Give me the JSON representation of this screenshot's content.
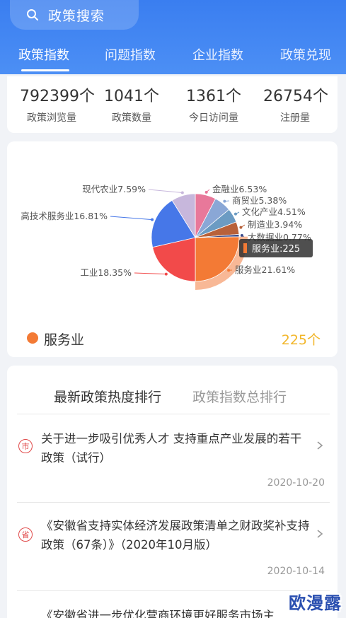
{
  "search": {
    "placeholder": "政策搜索",
    "icon": "search-icon"
  },
  "tabs": [
    {
      "label": "政策指数",
      "active": true
    },
    {
      "label": "问题指数"
    },
    {
      "label": "企业指数"
    },
    {
      "label": "政策兑现"
    }
  ],
  "stats": [
    {
      "value": "792399个",
      "label": "政策浏览量"
    },
    {
      "value": "1041个",
      "label": "政策数量"
    },
    {
      "value": "1361个",
      "label": "今日访问量"
    },
    {
      "value": "26754个",
      "label": "注册量"
    }
  ],
  "chart_data": {
    "type": "pie",
    "slices": [
      {
        "label": "金融业6.53%",
        "name": "金融业",
        "value": 6.53,
        "color": "#e8789a"
      },
      {
        "label": "商贸业5.38%",
        "name": "商贸业",
        "value": 5.38,
        "color": "#8aa7d6"
      },
      {
        "label": "文化产业4.51%",
        "name": "文化产业",
        "value": 4.51,
        "color": "#6b9bc3"
      },
      {
        "label": "制造业3.94%",
        "name": "制造业",
        "value": 3.94,
        "color": "#b8613a"
      },
      {
        "label": "大数据业0.77%",
        "name": "大数据业",
        "value": 0.77,
        "color": "#3a4a8a"
      },
      {
        "label": "服务业21.61%",
        "name": "服务业",
        "value": 21.61,
        "color": "#f37a35"
      },
      {
        "label": "工业18.35%",
        "name": "工业",
        "value": 18.35,
        "color": "#f24a4a"
      },
      {
        "label": "高技术服务业16.81%",
        "name": "高技术服务业",
        "value": 16.81,
        "color": "#4677e8"
      },
      {
        "label": "现代农业7.59%",
        "name": "现代农业",
        "value": 7.59,
        "color": "#c7b7dc"
      }
    ],
    "highlighted": "服务业",
    "tooltip": "服务业:225"
  },
  "legend": {
    "name": "服务业",
    "count": "225个",
    "color": "#f37a35"
  },
  "ranking_tabs": [
    "最新政策热度排行",
    "政策指数总排行"
  ],
  "policies": [
    {
      "badge": "市",
      "title": "关于进一步吸引优秀人才 支持重点产业发展的若干政策（试行）",
      "date": "2020-10-20"
    },
    {
      "badge": "省",
      "title": "《安徽省支持实体经济发展政策清单之财政奖补支持政策（67条）》（2020年10月版）",
      "date": "2020-10-14"
    },
    {
      "badge": "",
      "title": "《安徽省进一步优化营商环境更好服务市场主",
      "date": ""
    }
  ],
  "watermark": "欧漫露"
}
